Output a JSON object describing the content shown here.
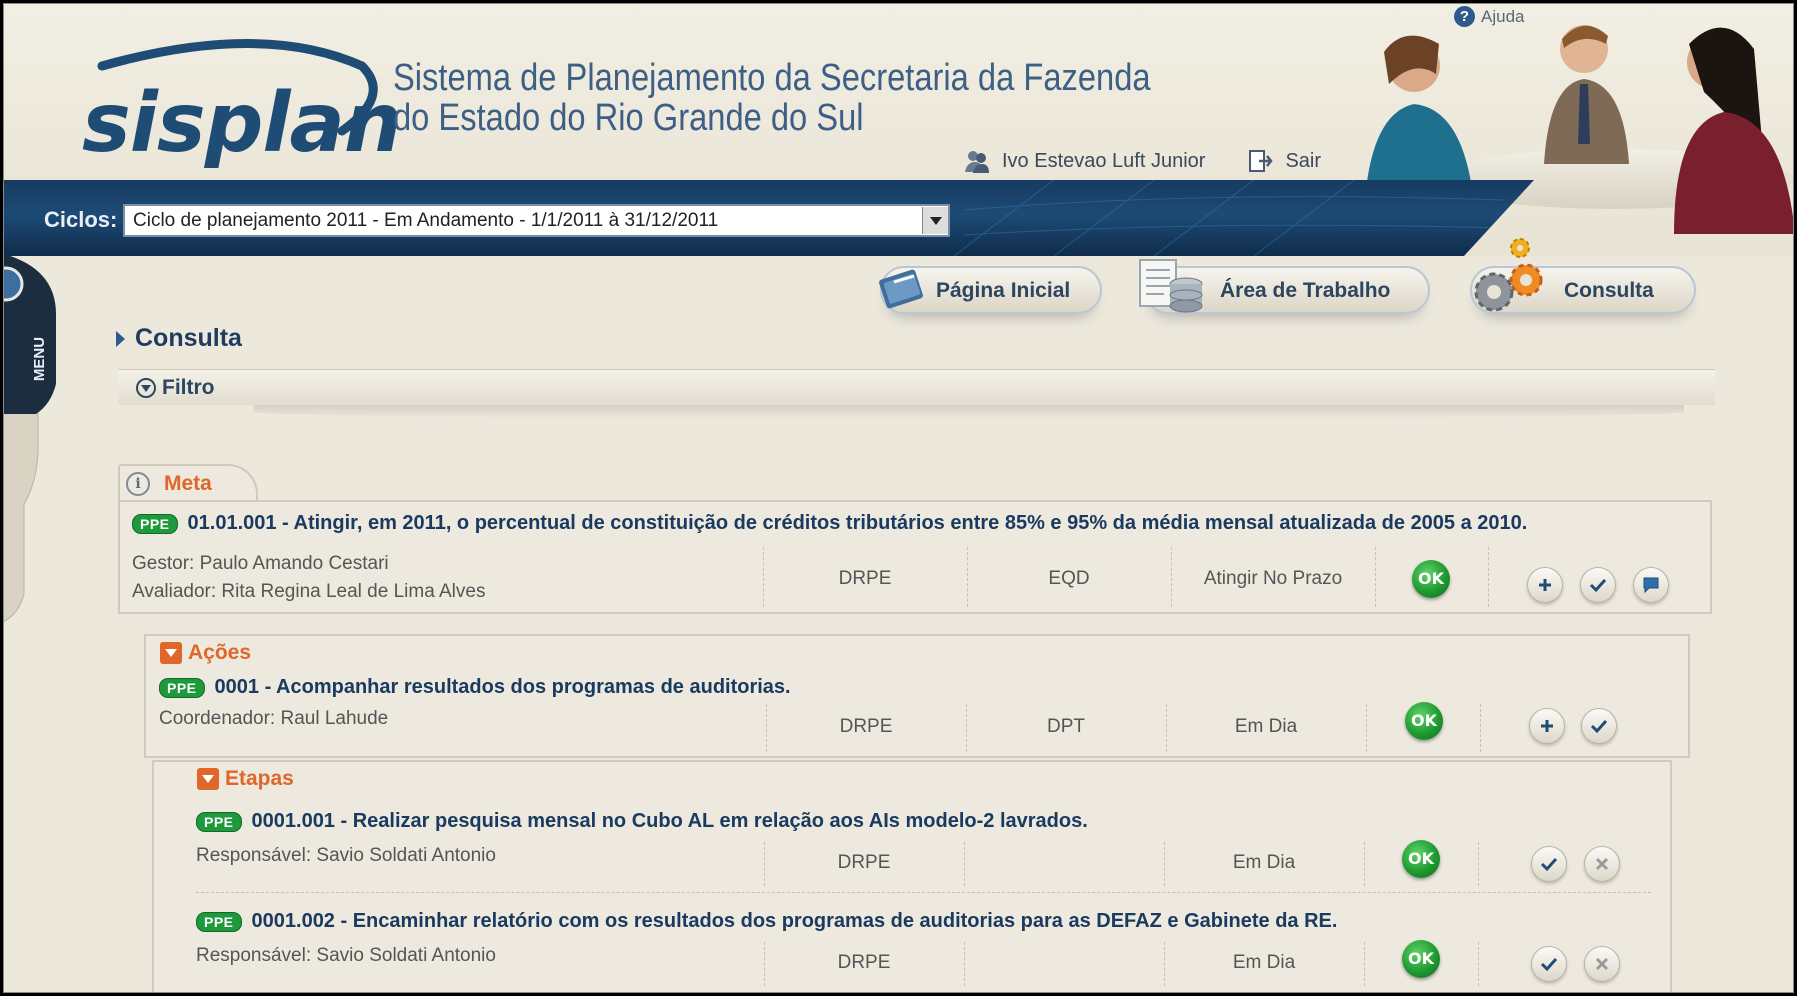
{
  "header": {
    "logo_text": "sisplan",
    "title_line1": "Sistema de Planejamento da Secretaria da Fazenda",
    "title_line2": "do Estado do Rio Grande do Sul",
    "help_label": "Ajuda",
    "user_name": "Ivo Estevao Luft Junior",
    "logout_label": "Sair"
  },
  "cycle": {
    "label": "Ciclos:",
    "selected": "Ciclo de planejamento 2011 - Em Andamento - 1/1/2011 à 31/12/2011"
  },
  "side_menu": {
    "label": "MENU"
  },
  "nav": {
    "home": "Página Inicial",
    "workspace": "Área de Trabalho",
    "query": "Consulta"
  },
  "page": {
    "title": "Consulta",
    "filter_label": "Filtro"
  },
  "meta": {
    "section_label": "Meta",
    "badge": "PPE",
    "title": "01.01.001 - Atingir, em 2011, o percentual de constituição de créditos tributários entre 85% e 95% da média mensal atualizada de 2005 a 2010.",
    "gestor": "Gestor: Paulo Amando Cestari",
    "avaliador": "Avaliador: Rita Regina Leal de Lima Alves",
    "col1": "DRPE",
    "col2": "EQD",
    "col3": "Atingir No Prazo",
    "status": "OK"
  },
  "acoes": {
    "section_label": "Ações",
    "badge": "PPE",
    "title": "0001 - Acompanhar resultados dos programas de auditorias.",
    "coordenador": "Coordenador: Raul Lahude",
    "col1": "DRPE",
    "col2": "DPT",
    "col3": "Em Dia",
    "status": "OK"
  },
  "etapas": {
    "section_label": "Etapas",
    "items": [
      {
        "badge": "PPE",
        "title": "0001.001 - Realizar pesquisa mensal no Cubo AL em relação aos AIs modelo-2 lavrados.",
        "responsavel": "Responsável: Savio Soldati Antonio",
        "col1": "DRPE",
        "col2": "",
        "col3": "Em Dia",
        "status": "OK"
      },
      {
        "badge": "PPE",
        "title": "0001.002 - Encaminhar relatório com os resultados dos programas de auditorias para as DEFAZ e Gabinete da RE.",
        "responsavel": "Responsável: Savio Soldati Antonio",
        "col1": "DRPE",
        "col2": "",
        "col3": "Em Dia",
        "status": "OK"
      }
    ]
  },
  "colors": {
    "title_blue": "#1a3a60",
    "section_orange": "#e0662a",
    "ok_green": "#1f9a31",
    "bar_navy": "#173a5f"
  }
}
